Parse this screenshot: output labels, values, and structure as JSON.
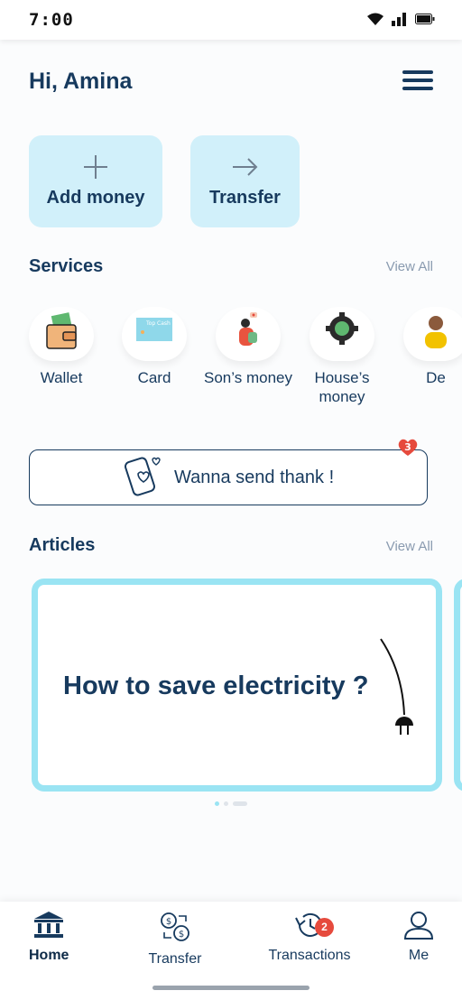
{
  "status_bar": {
    "time": "7:00"
  },
  "header": {
    "greeting": "Hi, Amina",
    "menu_icon": "hamburger-menu-icon"
  },
  "quick_actions": [
    {
      "label": "Add money",
      "icon": "plus-icon"
    },
    {
      "label": "Transfer",
      "icon": "arrow-right-icon"
    }
  ],
  "services": {
    "title": "Services",
    "view_all": "View All",
    "items": [
      {
        "label": "Wallet",
        "icon": "wallet-icon"
      },
      {
        "label": "Card",
        "icon": "card-icon",
        "card_text": "Top Cash"
      },
      {
        "label": "Son’s money",
        "icon": "son-icon"
      },
      {
        "label": "House’s money",
        "icon": "house-gear-icon"
      },
      {
        "label": "De",
        "icon": "person-icon"
      }
    ]
  },
  "thanks_banner": {
    "label": "Wanna send thank !",
    "badge_count": "3"
  },
  "articles": {
    "title": "Articles",
    "view_all": "View All",
    "items": [
      {
        "title": "How to save electricity ?"
      }
    ],
    "carousel_dots": 3,
    "active_dot": 0
  },
  "bottom_nav": {
    "items": [
      {
        "label": "Home",
        "icon": "bank-icon",
        "active": true
      },
      {
        "label": "Transfer",
        "icon": "currency-exchange-icon",
        "active": false
      },
      {
        "label": "Transactions",
        "icon": "history-icon",
        "active": false,
        "badge": "2"
      },
      {
        "label": "Me",
        "icon": "person-icon",
        "active": false
      }
    ]
  },
  "colors": {
    "primary": "#173a5e",
    "accent_light": "#d1f0fa",
    "accent": "#9ae4f3",
    "badge": "#e64a3d",
    "muted": "#8a9bb0"
  }
}
